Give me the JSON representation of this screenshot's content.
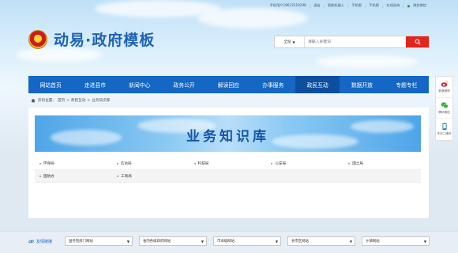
{
  "topbar": {
    "items": [
      "手机用户18623218298",
      "退出",
      "智能机器人",
      "手机版",
      "手机报",
      "在线咨询",
      "政务微信"
    ]
  },
  "header": {
    "site_title": "动易·政府模板",
    "search": {
      "scope": "全站",
      "placeholder": "请输入关键词"
    }
  },
  "nav": {
    "items": [
      {
        "label": "网站首页",
        "active": false
      },
      {
        "label": "走进县市",
        "active": false
      },
      {
        "label": "新闻中心",
        "active": false
      },
      {
        "label": "政务公开",
        "active": false
      },
      {
        "label": "解读回应",
        "active": false
      },
      {
        "label": "办事服务",
        "active": false
      },
      {
        "label": "政民互动",
        "active": true
      },
      {
        "label": "数据开放",
        "active": false
      },
      {
        "label": "专题专栏",
        "active": false
      }
    ]
  },
  "breadcrumb": {
    "prefix": "您的位置：",
    "items": [
      "首页",
      "政民互动",
      "业务知识库"
    ],
    "separator": ">"
  },
  "main": {
    "banner_title": "业务知识库",
    "categories": [
      [
        "环保局",
        "信访局",
        "科技局",
        "公安局",
        "国土局"
      ],
      [
        "国防办",
        "工商局"
      ]
    ]
  },
  "side": {
    "items": [
      {
        "label": "新浪微博",
        "icon": "weibo-icon"
      },
      {
        "label": "腾讯微信",
        "icon": "wechat-icon"
      },
      {
        "label": "本页二维码",
        "icon": "mobile-qrcode-icon"
      }
    ]
  },
  "links": {
    "title": "友情链接",
    "selects": [
      "国务院部门网站",
      "省内各级政府网站",
      "市本级网站",
      "县市区网站",
      "乡镇网站"
    ]
  },
  "colors": {
    "brand_blue": "#1467c4",
    "active_nav": "#0d4f9f",
    "search_red": "#e2261e"
  }
}
